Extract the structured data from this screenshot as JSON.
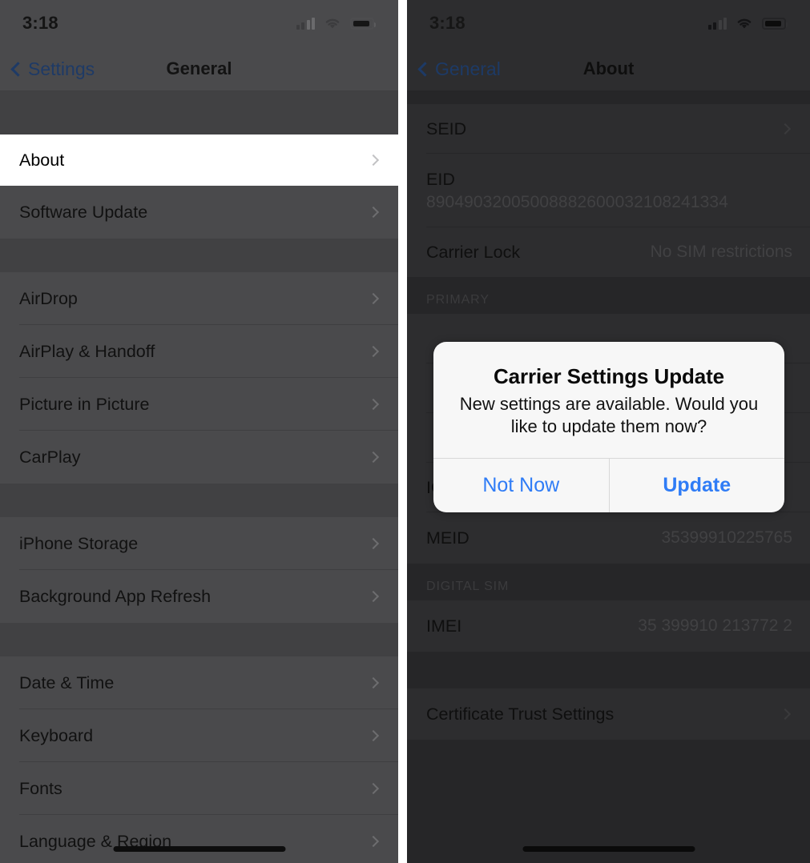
{
  "status_bar": {
    "time": "3:18",
    "signal_icon": "cellular-signal-icon",
    "signal_bars_total": 4,
    "signal_bars_filled": 2,
    "wifi_icon": "wifi-icon",
    "battery_icon": "battery-icon"
  },
  "left_screen": {
    "nav": {
      "back_label": "Settings",
      "back_icon": "chevron-left-icon",
      "title": "General"
    },
    "groups": [
      {
        "rows": [
          {
            "label": "About",
            "accessory": "chevron-right-icon",
            "highlighted": true
          },
          {
            "label": "Software Update",
            "accessory": "chevron-right-icon",
            "highlighted": false
          }
        ]
      },
      {
        "rows": [
          {
            "label": "AirDrop",
            "accessory": "chevron-right-icon",
            "highlighted": false
          },
          {
            "label": "AirPlay & Handoff",
            "accessory": "chevron-right-icon",
            "highlighted": false
          },
          {
            "label": "Picture in Picture",
            "accessory": "chevron-right-icon",
            "highlighted": false
          },
          {
            "label": "CarPlay",
            "accessory": "chevron-right-icon",
            "highlighted": false
          }
        ]
      },
      {
        "rows": [
          {
            "label": "iPhone Storage",
            "accessory": "chevron-right-icon",
            "highlighted": false
          },
          {
            "label": "Background App Refresh",
            "accessory": "chevron-right-icon",
            "highlighted": false
          }
        ]
      },
      {
        "rows": [
          {
            "label": "Date & Time",
            "accessory": "chevron-right-icon",
            "highlighted": false
          },
          {
            "label": "Keyboard",
            "accessory": "chevron-right-icon",
            "highlighted": false
          },
          {
            "label": "Fonts",
            "accessory": "chevron-right-icon",
            "highlighted": false
          },
          {
            "label": "Language & Region",
            "accessory": "chevron-right-icon",
            "highlighted": false
          }
        ]
      }
    ]
  },
  "right_screen": {
    "nav": {
      "back_label": "General",
      "back_icon": "chevron-left-icon",
      "title": "About"
    },
    "groups": [
      {
        "header": "",
        "rows": [
          {
            "label": "SEID",
            "value": "",
            "accessory": "chevron-right-icon",
            "stacked": false
          },
          {
            "label": "EID",
            "value": "89049032005008882600032108241334",
            "accessory": "",
            "stacked": true
          },
          {
            "label": "Carrier Lock",
            "value": "No SIM restrictions",
            "accessory": "",
            "stacked": false
          }
        ]
      },
      {
        "header": "PRIMARY",
        "rows": [
          {
            "label": "",
            "value": "",
            "accessory": "",
            "stacked": false,
            "obscured": true
          },
          {
            "label": "",
            "value": "",
            "accessory": "",
            "stacked": false,
            "obscured": true
          },
          {
            "label": "",
            "value": "",
            "accessory": "",
            "stacked": false,
            "obscured": true
          },
          {
            "label": "ICCID",
            "value": "",
            "accessory": "",
            "stacked": false,
            "obscured": true
          },
          {
            "label": "MEID",
            "value": "35399910225765",
            "accessory": "",
            "stacked": false
          }
        ]
      },
      {
        "header": "DIGITAL SIM",
        "rows": [
          {
            "label": "IMEI",
            "value": "35 399910 213772 2",
            "accessory": "",
            "stacked": false
          }
        ]
      },
      {
        "header": "",
        "rows": [
          {
            "label": "Certificate Trust Settings",
            "value": "",
            "accessory": "chevron-right-icon",
            "stacked": false
          }
        ]
      }
    ]
  },
  "alert": {
    "title": "Carrier Settings Update",
    "message": "New settings are available.  Would you like to update them now?",
    "cancel_label": "Not Now",
    "confirm_label": "Update",
    "accent_color": "#2f7cf6"
  }
}
